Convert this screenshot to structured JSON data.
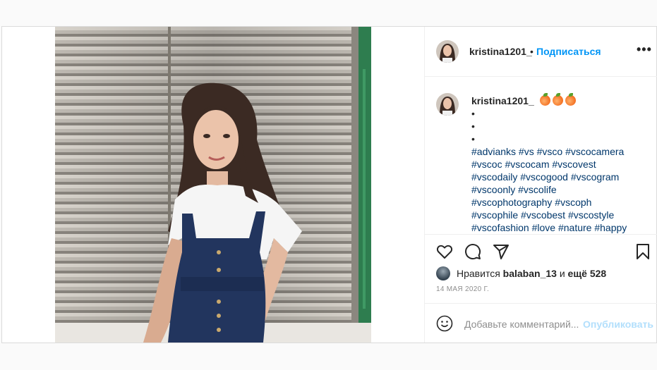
{
  "post": {
    "username": "kristina1201_",
    "dot": "•",
    "follow_label": "Подписаться",
    "more_label": "•••",
    "caption": {
      "username": "kristina1201_",
      "emoji": [
        "peach",
        "peach",
        "peach"
      ],
      "bullets": [
        "•",
        "•",
        "•"
      ],
      "hashtag_lines": [
        "#advianks #vs #vsco #vscocamera",
        "#vscoc #vscocam #vscovest",
        "#vscodaily #vscogood #vscogram",
        "#vscoonly #vscolife",
        "#vscophotography #vscoph",
        "#vscophile #vscobest #vscostyle",
        "#vscofashion #love #nature #happy"
      ]
    },
    "likes": {
      "prefix": "Нравится",
      "user": "balaban_13",
      "joiner": "и",
      "others": "ещё 528"
    },
    "date": "14 МАЯ 2020 Г.",
    "comment": {
      "placeholder": "Добавьте комментарий...",
      "publish_label": "Опубликовать"
    },
    "icons": [
      "heart-icon",
      "comment-icon",
      "share-icon",
      "bookmark-icon",
      "emoji-icon"
    ],
    "colors": {
      "link_blue": "#0095f6",
      "hashtag": "#00376b",
      "publish_disabled": "#b2dffc",
      "muted": "#8e8e8e"
    }
  }
}
